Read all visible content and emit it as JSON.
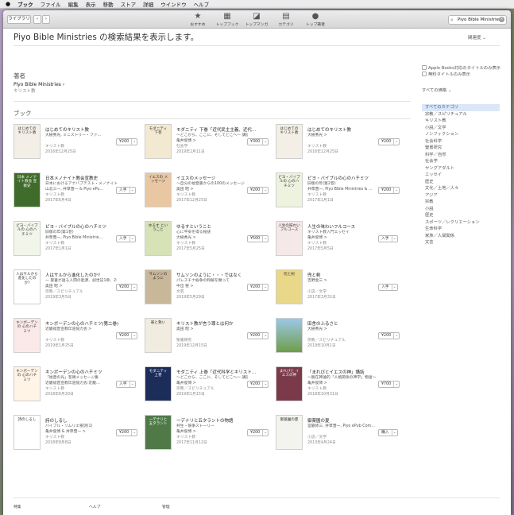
{
  "menubar": {
    "app": "ブック",
    "items": [
      "ファイル",
      "編集",
      "表示",
      "移動",
      "ストア",
      "詳細",
      "ウインドウ",
      "ヘルプ"
    ]
  },
  "toolbar": {
    "library_label": "ライブラリ",
    "tools": [
      {
        "label": "おすすめ",
        "icon": "star-icon"
      },
      {
        "label": "トップブック",
        "icon": "grid-icon"
      },
      {
        "label": "トップマンガ",
        "icon": "manga-icon"
      },
      {
        "label": "カテゴリ",
        "icon": "folder-icon"
      },
      {
        "label": "トップ著者",
        "icon": "person-icon"
      }
    ],
    "search_value": "Piyo Bible Ministries"
  },
  "page": {
    "title": "Piyo Bible Ministries の検索結果を表示します。",
    "sort": "関連度"
  },
  "author_section": {
    "heading": "著者",
    "name": "Piyo Bible Ministries",
    "genre": "キリスト教"
  },
  "filters": {
    "apple_books_only": "Apple Books対応のタイトルのみ表示",
    "free_only": "無料タイトルのみ表示",
    "price": "すべての価格"
  },
  "categories": [
    "すべてのカテゴリ",
    "宗教／スピリチュアル",
    "キリスト教",
    "小説／文学",
    "ノンフィクション",
    "社会科学",
    "聖書研究",
    "科学／自然",
    "社会学",
    "ヤングアダルト",
    "エッセイ",
    "歴史",
    "文化／土地／人々",
    "アジア",
    "宗教",
    "小説",
    "歴史",
    "スポーツ／レクリエーション",
    "生命科学",
    "家族／人間関係",
    "文芸"
  ],
  "books_heading": "ブック",
  "books": [
    {
      "title": "はじめてのキリスト教",
      "subtitle": "大樹秀光, ミニストリー・ファ…",
      "author": "",
      "genre": "キリスト教",
      "date": "2016年12月25日",
      "price": "¥200",
      "cover": "はじめての キリスト教"
    },
    {
      "title": "モダニティ 下巻「近代民主主義、近代…",
      "subtitle": "〜どこから、ここに、そしてどこへ〜 講話、「…",
      "author": "亀井俊博 >",
      "genre": "社会学",
      "date": "2019年2月11日",
      "price": "¥300",
      "cover": "モダニティ 下巻"
    },
    {
      "title": "はじめてのキリスト教",
      "subtitle": "大樹秀光 >",
      "author": "",
      "genre": "キリスト教",
      "date": "2016年12月25日",
      "price": "¥200",
      "cover": "はじめての キリスト教"
    },
    {
      "title": "日本メノナイト教会宣教史",
      "subtitle": "日本におけるアナバプテスト・メノナイト教会…",
      "author": "山北三一, 井草晋一 & Piyo ePu…",
      "genre": "キリスト教",
      "date": "2017年6月4日",
      "price": "入手",
      "cover": "日本 メノナイト教会 宣教史"
    },
    {
      "title": "イエスのメッセージ",
      "subtitle": "〜自分の福音書からの100のメッセージ",
      "author": "奥田 昭 >",
      "genre": "キリスト教",
      "date": "2017年12月25日",
      "price": "¥200",
      "cover": "イエスの メッセージ"
    },
    {
      "title": "ピヨ・バイブルの心のハチミツ",
      "subtitle": "旧版の年(第2巻)",
      "author": "井草晋一, Piyo Bible Ministries & …",
      "genre": "キリスト教",
      "date": "2017年1月1日",
      "price": "¥200",
      "cover": "ピヨ・バイブルの 心のハチミツ"
    },
    {
      "title": "ピヨ・バイブルの心のハチミツ",
      "subtitle": "旧版の年(第1巻)",
      "author": "井草晋一, Piyo Bible Ministrie…",
      "genre": "キリスト教",
      "date": "2017年1月1日",
      "price": "入手",
      "cover": "ピヨ・バイブルの 心のハチミツ"
    },
    {
      "title": "ゆるすということ",
      "subtitle": "心に平安を得る秘訣",
      "author": "大樹秀光 >",
      "genre": "キリスト教",
      "date": "2017年5月25日",
      "price": "¥500",
      "cover": "ゆるす ということ"
    },
    {
      "title": "人生の味わいフルコース",
      "subtitle": "キリスト教入門エッセイ",
      "author": "亀井俊博 >",
      "genre": "キリスト教",
      "date": "2017年5月5日",
      "price": "入手",
      "cover": "人生の味わい フルコース"
    },
    {
      "title": "人はサルから進化したのか?",
      "subtitle": "— 聖書が語る人間の起源、創世記1章、2章を…",
      "author": "奥田 昭 >",
      "genre": "宗教／スピリチュアル",
      "date": "2019年3月5日",
      "price": "¥200",
      "cover": "人はサルから 進化したのか?"
    },
    {
      "title": "サムソンのように・・・ではなく",
      "subtitle": "パレスチナ紛争の和解を願って",
      "author": "中出 聖 >",
      "genre": "文芸",
      "date": "2019年5月29日",
      "price": "¥200",
      "cover": "サムソンの ように"
    },
    {
      "title": "兜と剣",
      "subtitle": "吉野金三 >",
      "author": "",
      "genre": "小説／文学",
      "date": "2017年3月31日",
      "price": "入手",
      "cover": "兜と剣"
    },
    {
      "title": "キンボーデンの心のハチミツ(第二巻)",
      "subtitle": "近畿福音宣教伝道協力会 >",
      "author": "",
      "genre": "キリスト教",
      "date": "2019年1月25日",
      "price": "¥200",
      "cover": "キンボーデンの 心のハチミツ"
    },
    {
      "title": "キリスト教が言う罪とは何か",
      "subtitle": "奥田 昭 >",
      "author": "",
      "genre": "聖書研究",
      "date": "2019年12月15日",
      "price": "¥200",
      "cover": "罪と救い"
    },
    {
      "title": "田舎のふるさと",
      "subtitle": "大樹秀光 >",
      "author": "",
      "genre": "宗教／スピリチュアル",
      "date": "2019年10月1日",
      "price": "¥200",
      "cover": ""
    },
    {
      "title": "キンボーデンの心のハチミツ",
      "subtitle": "「福音の光」巻頭メッセージ集",
      "author": "近畿福音宣教伝道協力会:近畿…",
      "genre": "キリスト教",
      "date": "2018年6月20日",
      "price": "入手",
      "cover": "キンボーデンの 心のハチミツ"
    },
    {
      "title": "モダニティ 上巻「近代科学とキリスト…",
      "subtitle": "〜どこから、ここに、そしてどこへ〜 講話、「…",
      "author": "亀井俊博 >",
      "genre": "宗教／スピリチュアル",
      "date": "2019年1月15日",
      "price": "¥200",
      "cover": "モダニティ 上巻"
    },
    {
      "title": "「まれびとイエスの神」講話",
      "subtitle": "〜脱在神論的「人格関係の神学」物語〜",
      "author": "亀井俊博 >",
      "genre": "キリスト教",
      "date": "2018年10月31日",
      "price": "¥700",
      "cover": "まれびと イエスの神"
    },
    {
      "title": "詩のしるし",
      "subtitle": "バイブル・ソムリエ聖詩(1)",
      "author": "亀井俊博 & 井草晋一 >",
      "genre": "キリスト教",
      "date": "2018年8月8日",
      "price": "¥200",
      "cover": "詩のしるし"
    },
    {
      "title": "一デナリと五タラントの物語",
      "subtitle": "共生・競争ストーリー",
      "author": "亀井俊博 >",
      "genre": "キリスト教",
      "date": "2017年11月12日",
      "price": "¥200",
      "cover": "一デナリと 五タラント"
    },
    {
      "title": "御薬園の夏",
      "subtitle": "宮脇修三, 井草晋一, Piyo ePub Com…",
      "author": "",
      "genre": "小説／文学",
      "date": "2013年4月24日",
      "price": "購入",
      "cover": "御薬園の夏"
    }
  ],
  "footer": [
    "特集",
    "ヘルプ",
    "管理"
  ]
}
